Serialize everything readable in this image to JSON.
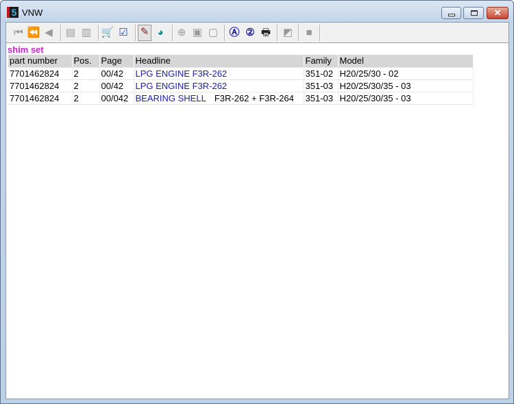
{
  "window": {
    "title": "VNW",
    "app_icon_text": "5"
  },
  "subtitle": "shim set",
  "table": {
    "headers": [
      "part number",
      "Pos.",
      "Page",
      "Headline",
      "Family",
      "Model"
    ],
    "rows": [
      {
        "part": "7701462824",
        "pos": "2",
        "page": "00/42",
        "headline": "LPG ENGINE  F3R-262",
        "headline_extra": "",
        "family": "351-02",
        "model": "H20/25/30 - 02"
      },
      {
        "part": "7701462824",
        "pos": "2",
        "page": "00/42",
        "headline": "LPG ENGINE  F3R-262",
        "headline_extra": "",
        "family": "351-03",
        "model": "H20/25/30/35 - 03"
      },
      {
        "part": "7701462824",
        "pos": "2",
        "page": "00/042",
        "headline": "BEARING SHELL",
        "headline_extra": "F3R-262 + F3R-264",
        "family": "351-03",
        "model": "H20/25/30/35 - 03"
      }
    ]
  },
  "colors": {
    "subtitle": "#d020d0",
    "link": "#1c1cb0",
    "header_bg": "#d6d6d6"
  }
}
